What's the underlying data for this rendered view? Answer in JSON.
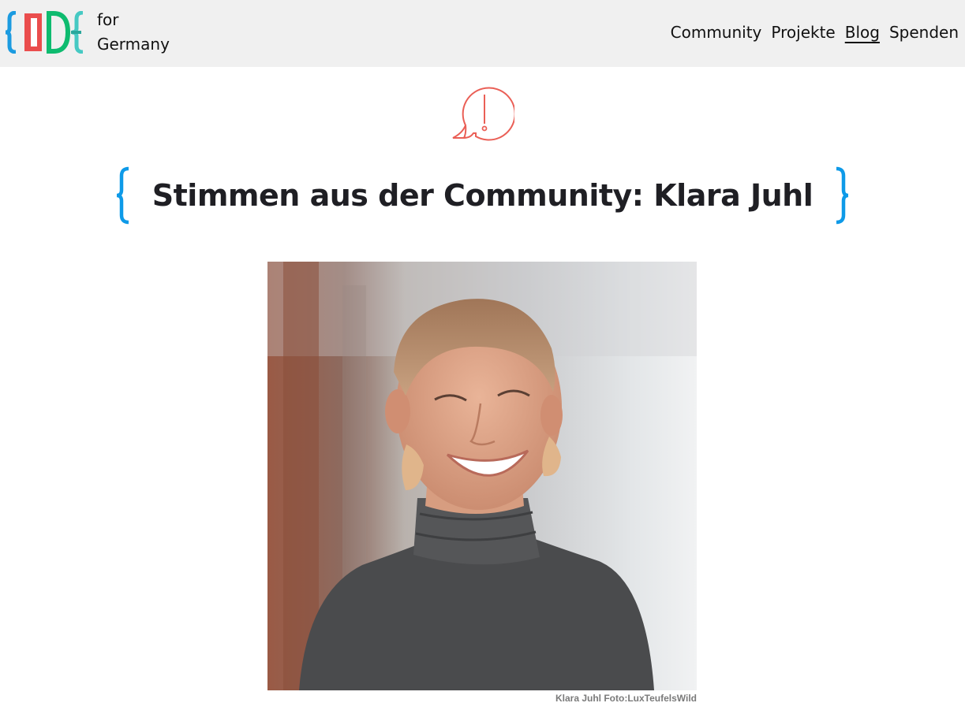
{
  "header": {
    "logo_line1": "for",
    "logo_line2": "Germany",
    "nav": [
      {
        "label": "Community",
        "active": false
      },
      {
        "label": "Projekte",
        "active": false
      },
      {
        "label": "Blog",
        "active": true
      },
      {
        "label": "Spenden",
        "active": false
      }
    ]
  },
  "article": {
    "title": "Stimmen aus der Community: Klara Juhl",
    "photo_caption": "Klara Juhl Foto:LuxTeufelsWild"
  },
  "colors": {
    "header_bg": "#f0f0f0",
    "brace_blue": "#0e9ae8",
    "alert_red": "#ea5f56"
  }
}
